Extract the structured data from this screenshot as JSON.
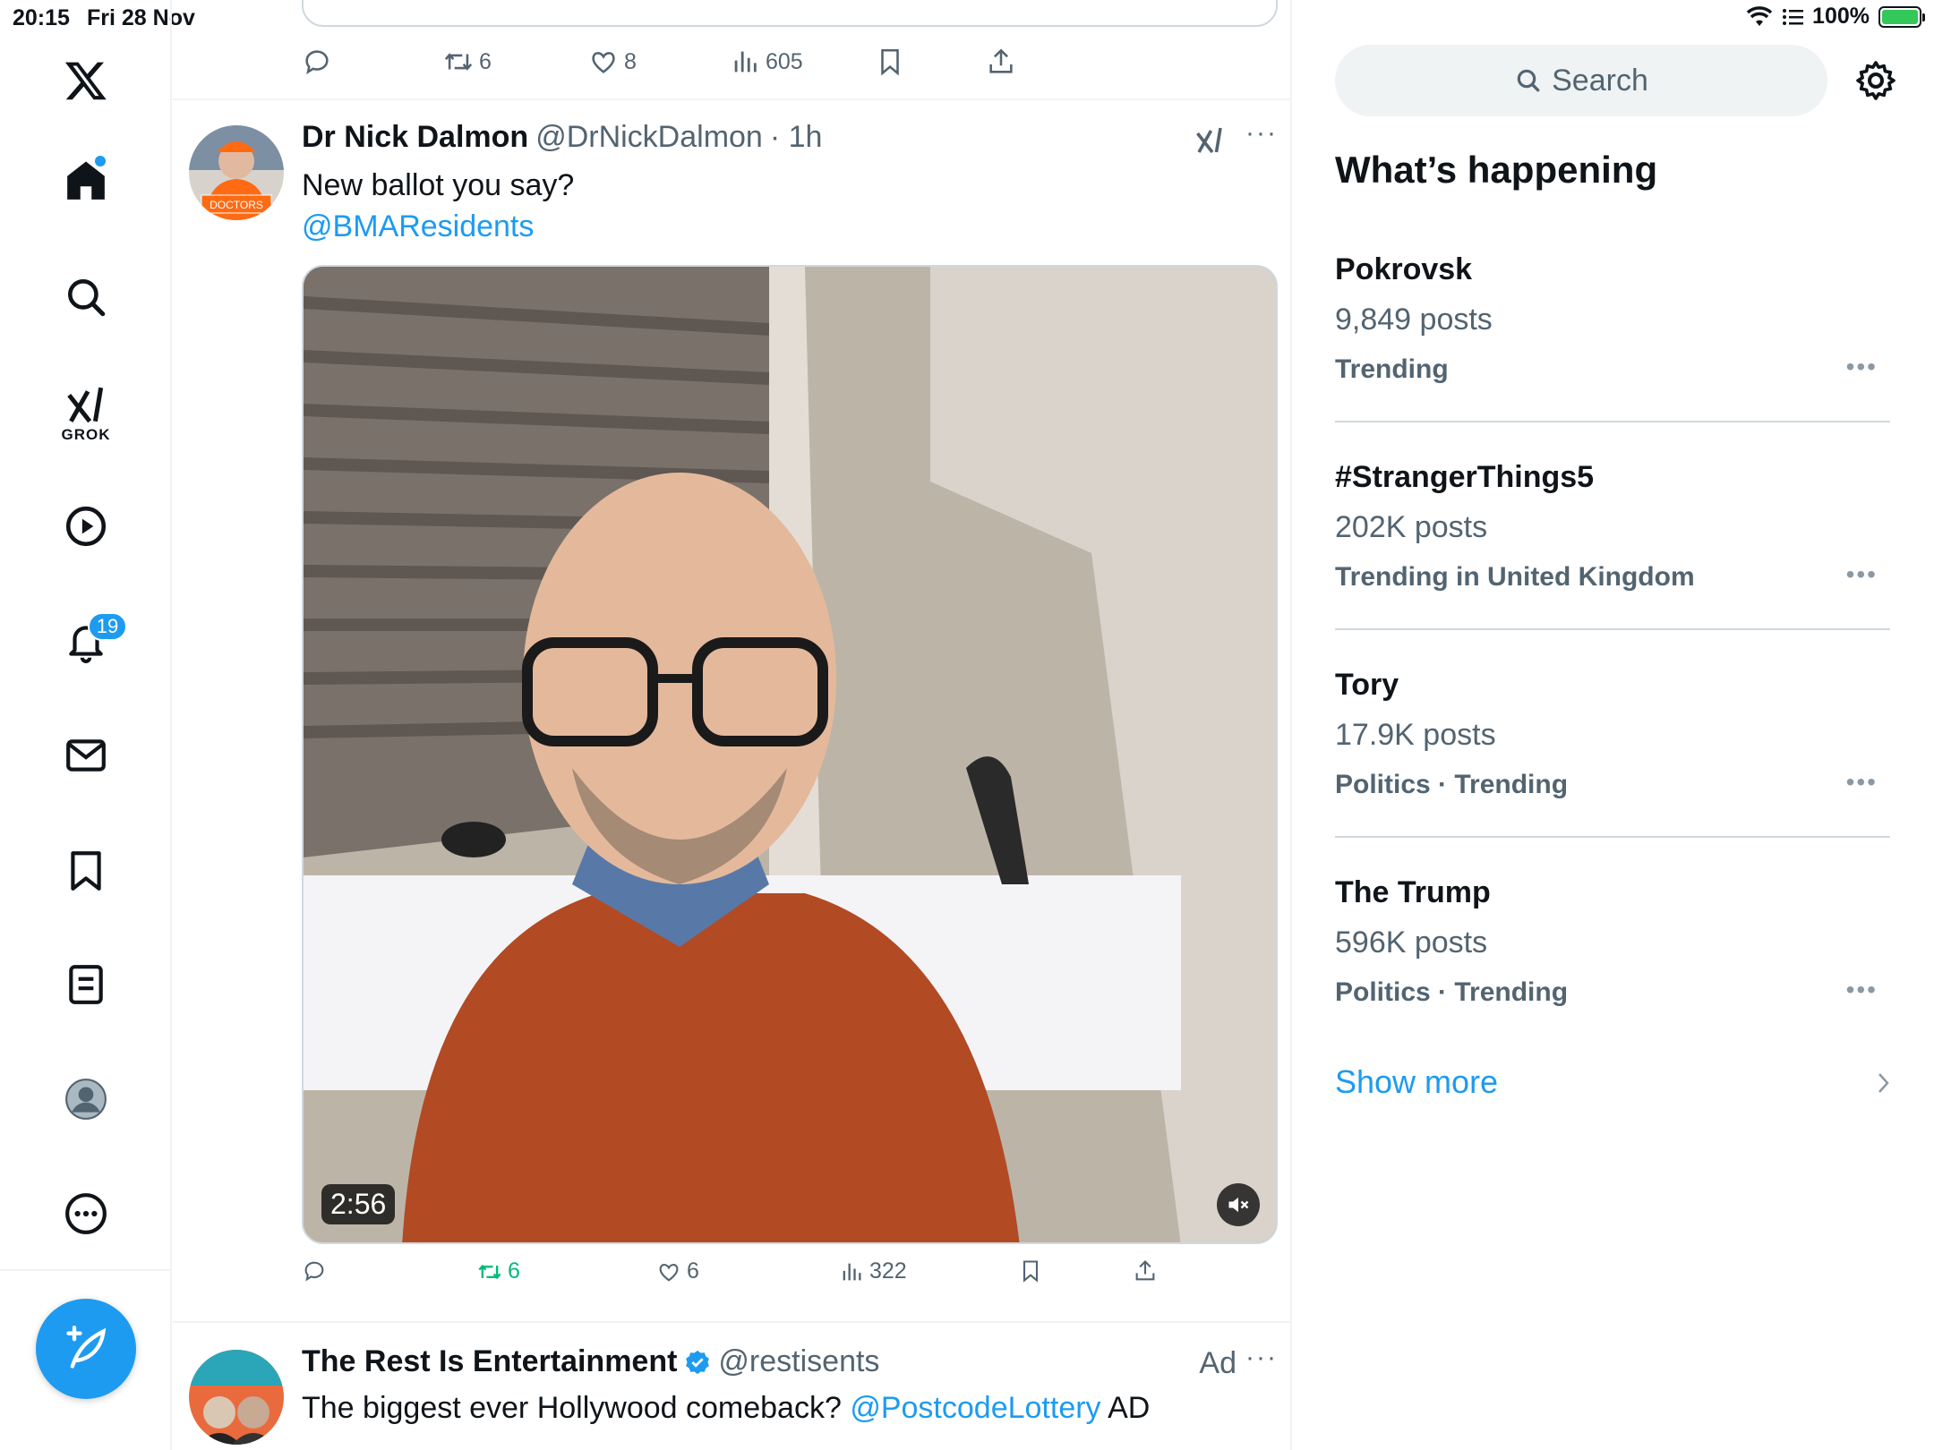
{
  "status_bar": {
    "time": "20:15",
    "date": "Fri 28 Nov",
    "battery": "100%"
  },
  "nav": {
    "grok_label": "GROK",
    "notifications_count": "19",
    "items": [
      "home",
      "search",
      "grok",
      "video",
      "notifications",
      "messages",
      "bookmarks",
      "lists",
      "profile",
      "more"
    ]
  },
  "prev_post": {
    "retweets": "6",
    "likes": "8",
    "views": "605"
  },
  "post": {
    "name": "Dr Nick Dalmon",
    "handle": "@DrNickDalmon",
    "time": "· 1h",
    "text": "New ballot you say?",
    "mention": "@BMAResidents",
    "avatar_sign": "DOCTORS",
    "video_duration": "2:56",
    "retweets": "6",
    "likes": "6",
    "views": "322"
  },
  "ad_post": {
    "name": "The Rest Is Entertainment",
    "handle": "@restisents",
    "ad_label": "Ad",
    "text_before": "The biggest ever Hollywood comeback? ",
    "mention": "@PostcodeLottery",
    "text_after": " AD"
  },
  "sidebar": {
    "search_placeholder": "Search",
    "title": "What’s happening",
    "trends": [
      {
        "name": "Pokrovsk",
        "count": "9,849 posts",
        "context": "Trending"
      },
      {
        "name": "#StrangerThings5",
        "count": "202K posts",
        "context": "Trending in United Kingdom"
      },
      {
        "name": "Tory",
        "count": "17.9K posts",
        "context": "Politics · Trending"
      },
      {
        "name": "The Trump",
        "count": "596K posts",
        "context": "Politics · Trending"
      }
    ],
    "show_more": "Show more"
  },
  "colors": {
    "accent": "#1d9bf0",
    "retweet_active": "#00ba7c",
    "muted_text": "#536471"
  }
}
